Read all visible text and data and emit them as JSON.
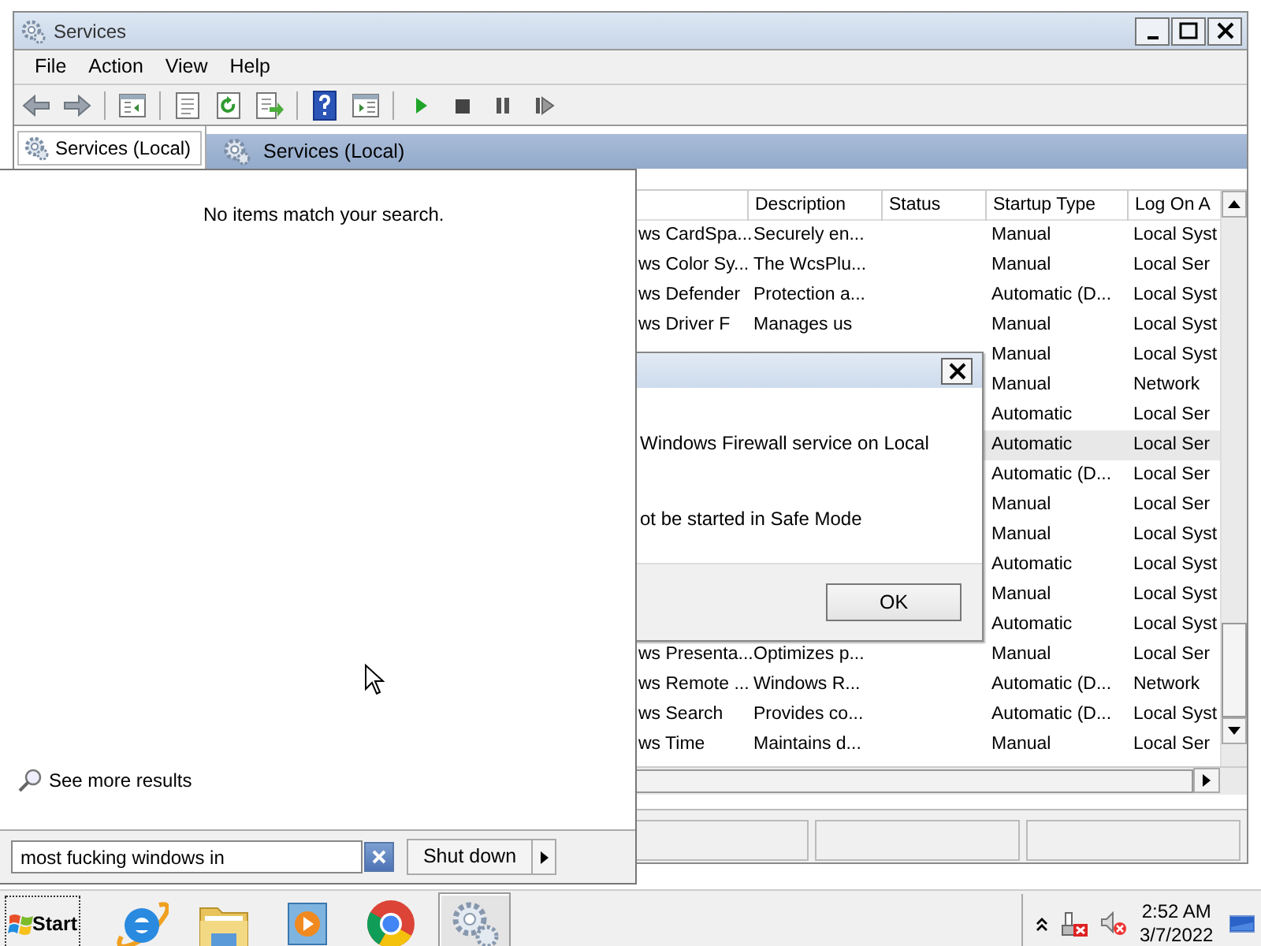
{
  "window": {
    "title": "Services"
  },
  "menu": [
    "File",
    "Action",
    "View",
    "Help"
  ],
  "toolbar": [
    {
      "kind": "back"
    },
    {
      "kind": "forward"
    },
    {
      "kind": "separator"
    },
    {
      "kind": "tree"
    },
    {
      "kind": "separator"
    },
    {
      "kind": "properties"
    },
    {
      "kind": "refresh"
    },
    {
      "kind": "export"
    },
    {
      "kind": "separator"
    },
    {
      "kind": "help"
    },
    {
      "kind": "action_pane"
    },
    {
      "kind": "separator"
    },
    {
      "kind": "play"
    },
    {
      "kind": "stop"
    },
    {
      "kind": "pause"
    },
    {
      "kind": "resume"
    }
  ],
  "tree": {
    "items": [
      {
        "label": "Services (Local)",
        "selected": true
      }
    ]
  },
  "pane_header": "Services (Local)",
  "table": {
    "columns": [
      "Description",
      "Status",
      "Startup Type",
      "Log On A"
    ],
    "rows": [
      {
        "name": "ws CardSpa...",
        "description": "Securely en...",
        "startup_type": "Manual",
        "log_on_as": "Local Syst",
        "selected": false
      },
      {
        "name": "ws Color Sy...",
        "description": "The WcsPlu...",
        "startup_type": "Manual",
        "log_on_as": "Local Ser",
        "selected": false
      },
      {
        "name": "ws Defender",
        "description": "Protection a...",
        "startup_type": "Automatic (D...",
        "log_on_as": "Local Syst",
        "selected": false
      },
      {
        "name": "ws Driver F",
        "description": "Manages us",
        "startup_type": "Manual",
        "log_on_as": "Local Syst",
        "selected": false
      },
      {
        "startup_type": "Manual",
        "log_on_as": "Local Syst",
        "selected": false
      },
      {
        "startup_type": "Manual",
        "log_on_as": "Network",
        "selected": false
      },
      {
        "startup_type": "Automatic",
        "log_on_as": "Local Ser",
        "selected": false
      },
      {
        "startup_type": "Automatic",
        "log_on_as": "Local Ser",
        "selected": true
      },
      {
        "startup_type": "Automatic (D...",
        "log_on_as": "Local Ser",
        "selected": false
      },
      {
        "startup_type": "Manual",
        "log_on_as": "Local Ser",
        "selected": false
      },
      {
        "startup_type": "Manual",
        "log_on_as": "Local Syst",
        "selected": false
      },
      {
        "startup_type": "Automatic",
        "log_on_as": "Local Syst",
        "selected": false
      },
      {
        "startup_type": "Manual",
        "log_on_as": "Local Syst",
        "selected": false
      },
      {
        "startup_type": "Automatic",
        "log_on_as": "Local Syst",
        "selected": false
      },
      {
        "name": "ws Presenta...",
        "description": "Optimizes p...",
        "startup_type": "Manual",
        "log_on_as": "Local Ser",
        "selected": false
      },
      {
        "name": "ws Remote ...",
        "description": "Windows R...",
        "startup_type": "Automatic (D...",
        "log_on_as": "Network",
        "selected": false
      },
      {
        "name": "ws Search",
        "description": "Provides co...",
        "startup_type": "Automatic (D...",
        "log_on_as": "Local Syst",
        "selected": false
      },
      {
        "name": "ws Time",
        "description": "Maintains d...",
        "startup_type": "Manual",
        "log_on_as": "Local Ser",
        "selected": false
      }
    ]
  },
  "dialog": {
    "lines": [
      "Windows Firewall service on Local",
      "ot be started in Safe Mode"
    ],
    "buttons": [
      "OK"
    ]
  },
  "start_menu": {
    "empty_message": "No items match your search.",
    "see_more": "See more results",
    "search": {
      "value": "most fucking windows in"
    },
    "shutdown": "Shut down"
  },
  "taskbar": {
    "start": "Start",
    "apps": [
      {
        "kind": "ie",
        "active": false
      },
      {
        "kind": "explorer",
        "active": false
      },
      {
        "kind": "media",
        "active": false
      },
      {
        "kind": "chrome",
        "active": false
      },
      {
        "kind": "services",
        "active": true
      }
    ],
    "tray": {
      "time": "2:52 AM",
      "date": "3/7/2022"
    }
  }
}
